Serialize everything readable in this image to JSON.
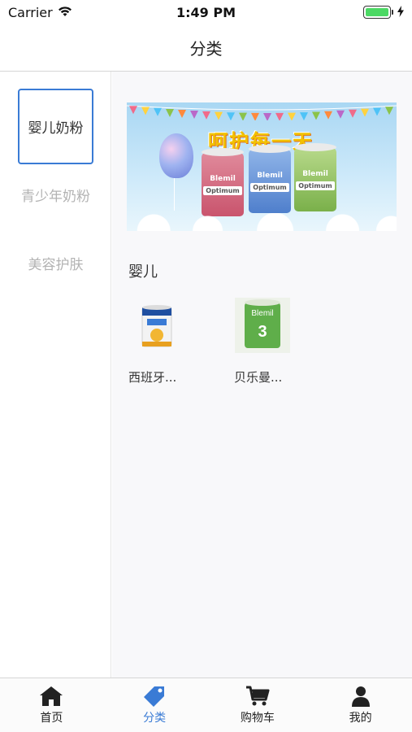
{
  "status_bar": {
    "carrier": "Carrier",
    "time": "1:49 PM"
  },
  "nav": {
    "title": "分类"
  },
  "sidebar": {
    "items": [
      {
        "label": "婴儿奶粉",
        "active": true
      },
      {
        "label": "青少年奶粉",
        "active": false
      },
      {
        "label": "美容护肤",
        "active": false
      }
    ]
  },
  "banner": {
    "headline": "呵护每一天",
    "brand": "Blemil",
    "product_line": "Optimum"
  },
  "section": {
    "title": "婴儿"
  },
  "products": [
    {
      "name": "西班牙..."
    },
    {
      "name": "贝乐曼..."
    }
  ],
  "tabs": [
    {
      "label": "首页",
      "icon": "home-icon"
    },
    {
      "label": "分类",
      "icon": "tag-icon"
    },
    {
      "label": "购物车",
      "icon": "cart-icon"
    },
    {
      "label": "我的",
      "icon": "user-icon"
    }
  ],
  "colors": {
    "accent": "#3a7bd5",
    "battery": "#4cd964"
  }
}
